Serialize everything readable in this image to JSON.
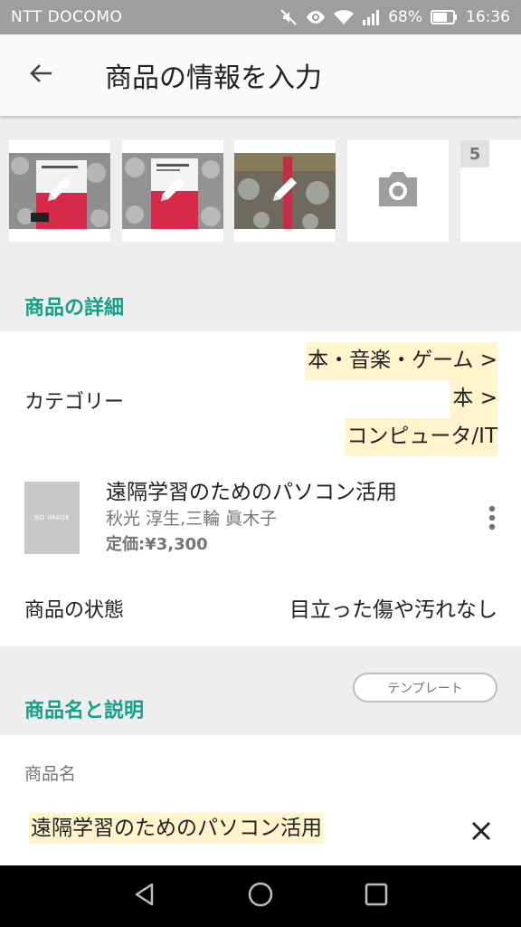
{
  "status_bar": {
    "carrier": "NTT DOCOMO",
    "battery_percent": "68%",
    "time": "16:36"
  },
  "app_bar": {
    "title": "商品の情報を入力"
  },
  "photos": {
    "next_slot_number": "5"
  },
  "details": {
    "section_title": "商品の詳細",
    "category_label": "カテゴリー",
    "category_path": [
      "本・音楽・ゲーム >",
      "本 >",
      "コンピュータ/IT"
    ],
    "book": {
      "thumb_text": "NO IMAGE",
      "title": "遠隔学習のためのパソコン活用",
      "author": "秋光 淳生,三輪 眞木子",
      "price": "定価:¥3,300"
    },
    "condition_label": "商品の状態",
    "condition_value": "目立った傷や汚れなし"
  },
  "name_section": {
    "title": "商品名と説明",
    "template_button": "テンプレート",
    "name_label": "商品名",
    "name_value": "遠隔学習のためのパソコン活用"
  },
  "colors": {
    "accent": "#16a089",
    "highlight": "#fff4cc"
  }
}
